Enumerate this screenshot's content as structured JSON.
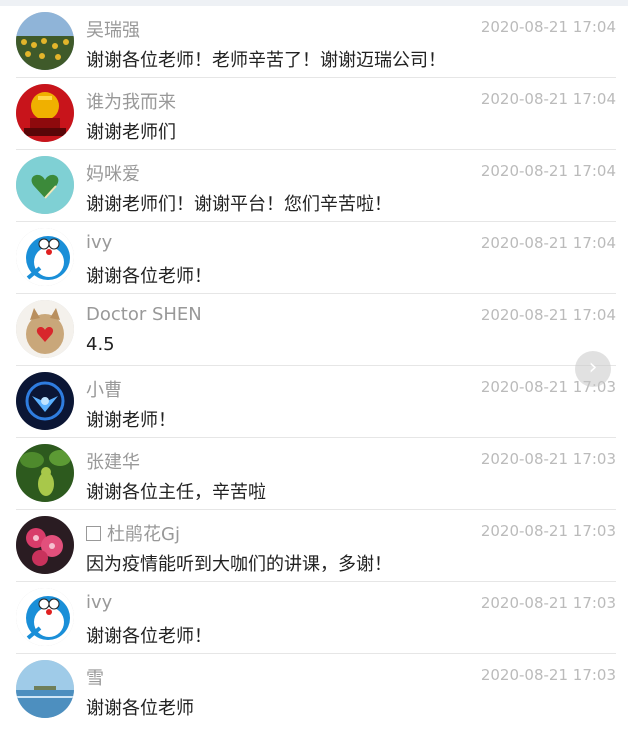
{
  "comments": [
    {
      "name": "吴瑞强",
      "time": "2020-08-21 17:04",
      "text": "谢谢各位老师！老师辛苦了！谢谢迈瑞公司！",
      "avatar": "sunflower-field-avatar"
    },
    {
      "name": "谁为我而来",
      "time": "2020-08-21 17:04",
      "text": "谢谢老师们",
      "avatar": "tiananmen-avatar"
    },
    {
      "name": "妈咪爱",
      "time": "2020-08-21 17:04",
      "text": "谢谢老师们！谢谢平台！您们辛苦啦！",
      "avatar": "heart-island-avatar"
    },
    {
      "name": "ivy",
      "time": "2020-08-21 17:04",
      "text": "谢谢各位老师！",
      "avatar": "doraemon-avatar"
    },
    {
      "name": "Doctor SHEN",
      "time": "2020-08-21 17:04",
      "text": "4.5",
      "avatar": "cat-heart-avatar"
    },
    {
      "name": "小曹",
      "time": "2020-08-21 17:03",
      "text": "谢谢老师！",
      "avatar": "blue-emblem-avatar"
    },
    {
      "name": "张建华",
      "time": "2020-08-21 17:03",
      "text": "谢谢各位主任，辛苦啦",
      "avatar": "gourd-plant-avatar"
    },
    {
      "name": "杜鹃花Gj",
      "time": "2020-08-21 17:03",
      "text": "因为疫情能听到大咖们的讲课，多谢！",
      "avatar": "flower-avatar",
      "checkbox": true
    },
    {
      "name": "ivy",
      "time": "2020-08-21 17:03",
      "text": "谢谢各位老师！",
      "avatar": "doraemon-avatar"
    },
    {
      "name": "雪",
      "time": "2020-08-21 17:03",
      "text": "谢谢各位老师",
      "avatar": "lake-avatar"
    }
  ],
  "next_button": {
    "icon": "chevron-right-icon",
    "glyph": "›"
  }
}
